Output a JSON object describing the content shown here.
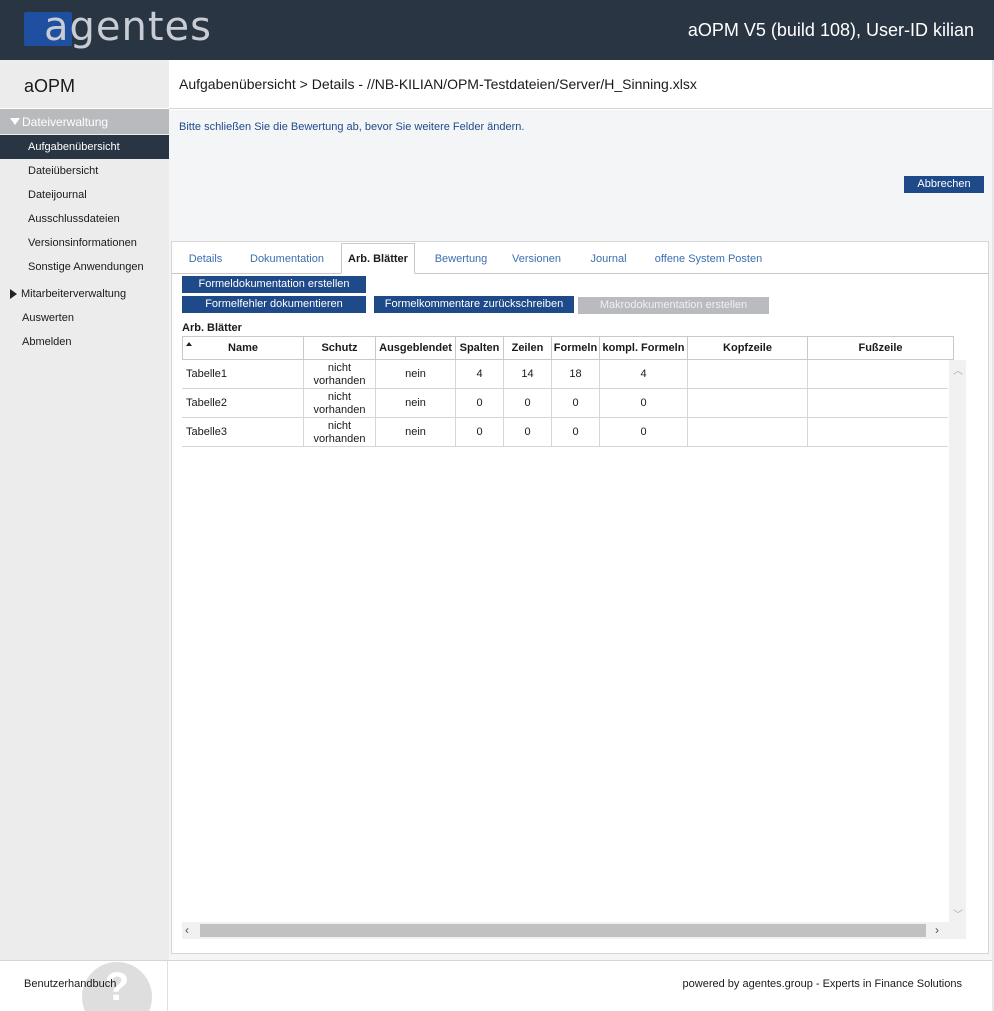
{
  "header": {
    "logo_text": "agentes",
    "app_title": "aOPM V5 (build 108), User-ID kilian"
  },
  "sidebar": {
    "app_name": "aOPM",
    "group_dateiverwaltung": "Dateiverwaltung",
    "items": [
      {
        "label": "Aufgabenübersicht",
        "active": true
      },
      {
        "label": "Dateiübersicht"
      },
      {
        "label": "Dateijournal"
      },
      {
        "label": "Ausschlussdateien"
      },
      {
        "label": "Versionsinformationen"
      },
      {
        "label": "Sonstige Anwendungen"
      }
    ],
    "group_mitarbeiter": "Mitarbeiterverwaltung",
    "auswerten": "Auswerten",
    "abmelden": "Abmelden"
  },
  "breadcrumb": "Aufgabenübersicht > Details - //NB-KILIAN/OPM-Testdateien/Server/H_Sinning.xlsx",
  "info_message": "Bitte schließen Sie die Bewertung ab, bevor Sie weitere Felder ändern.",
  "cancel_button": "Abbrechen",
  "tabs": [
    {
      "label": "Details"
    },
    {
      "label": "Dokumentation"
    },
    {
      "label": "Arb. Blätter",
      "active": true
    },
    {
      "label": "Bewertung"
    },
    {
      "label": "Versionen"
    },
    {
      "label": "Journal"
    },
    {
      "label": "offene System Posten"
    }
  ],
  "actions": {
    "formeldoku": "Formeldokumentation erstellen",
    "formelfehler": "Formelfehler dokumentieren",
    "formelkommentare": "Formelkommentare zurückschreiben",
    "makrodoku": "Makrodokumentation erstellen"
  },
  "sheet_section_title": "Arb. Blätter",
  "table": {
    "columns": [
      "Name",
      "Schutz",
      "Ausgeblendet",
      "Spalten",
      "Zeilen",
      "Formeln",
      "kompl. Formeln",
      "Kopfzeile",
      "Fußzeile"
    ],
    "rows": [
      {
        "name": "Tabelle1",
        "schutz": "nicht vorhanden",
        "ausgeblendet": "nein",
        "spalten": "4",
        "zeilen": "14",
        "formeln": "18",
        "kompl": "4",
        "kopfzeile": "",
        "fusszeile": ""
      },
      {
        "name": "Tabelle2",
        "schutz": "nicht vorhanden",
        "ausgeblendet": "nein",
        "spalten": "0",
        "zeilen": "0",
        "formeln": "0",
        "kompl": "0",
        "kopfzeile": "",
        "fusszeile": ""
      },
      {
        "name": "Tabelle3",
        "schutz": "nicht vorhanden",
        "ausgeblendet": "nein",
        "spalten": "0",
        "zeilen": "0",
        "formeln": "0",
        "kompl": "0",
        "kopfzeile": "",
        "fusszeile": ""
      }
    ]
  },
  "footer": {
    "manual": "Benutzerhandbuch",
    "powered_by": "powered by agentes.group - Experts in Finance Solutions",
    "help_glyph": "?"
  },
  "colors": {
    "header_bg": "#2a3544",
    "accent_blue": "#1e4a8a",
    "tab_link": "#3b6fb0",
    "disabled_button": "#b9bbbf"
  }
}
